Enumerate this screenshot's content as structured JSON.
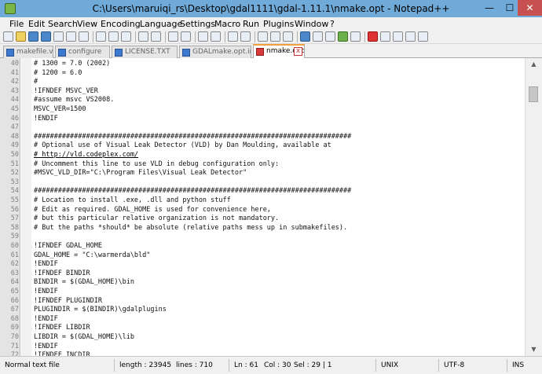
{
  "window": {
    "title": "C:\\Users\\maruiqi_rs\\Desktop\\gdal1111\\gdal-1.11.1\\nmake.opt - Notepad++",
    "minimize_glyph": "—",
    "maximize_glyph": "☐",
    "close_glyph": "✕"
  },
  "menu": [
    "File",
    "Edit",
    "Search",
    "View",
    "Encoding",
    "Language",
    "Settings",
    "Macro",
    "Run",
    "Plugins",
    "Window",
    "?"
  ],
  "tabs": [
    {
      "label": "makefile.vc",
      "active": false
    },
    {
      "label": "configure",
      "active": false
    },
    {
      "label": "LICENSE.TXT",
      "active": false
    },
    {
      "label": "GDALmake.opt.in",
      "active": false
    },
    {
      "label": "nmake.opt",
      "active": true
    }
  ],
  "tab_close_glyph": "x",
  "editor": {
    "current_line": 61,
    "highlighted_line": 61,
    "lines": [
      {
        "n": "40",
        "text": "# 1300 = 7.0 (2002)"
      },
      {
        "n": "41",
        "text": "# 1200 = 6.0"
      },
      {
        "n": "42",
        "text": "#"
      },
      {
        "n": "43",
        "text": "!IFNDEF MSVC_VER"
      },
      {
        "n": "44",
        "text": "#assume msvc VS2008."
      },
      {
        "n": "45",
        "text": "MSVC_VER=1500"
      },
      {
        "n": "46",
        "text": "!ENDIF"
      },
      {
        "n": "47",
        "text": ""
      },
      {
        "n": "48",
        "text": "###############################################################################"
      },
      {
        "n": "49",
        "text": "# Optional use of Visual Leak Detector (VLD) by Dan Moulding, available at"
      },
      {
        "n": "50",
        "text": "# http://vld.codeplex.com/"
      },
      {
        "n": "51",
        "text": "# Uncomment this line to use VLD in debug configuration only:"
      },
      {
        "n": "52",
        "text": "#MSVC_VLD_DIR=\"C:\\Program Files\\Visual Leak Detector\""
      },
      {
        "n": "53",
        "text": ""
      },
      {
        "n": "54",
        "text": "###############################################################################"
      },
      {
        "n": "55",
        "text": "# Location to install .exe, .dll and python stuff"
      },
      {
        "n": "56",
        "text": "# Edit as required. GDAL_HOME is used for convenience here,"
      },
      {
        "n": "57",
        "text": "# but this particular relative organization is not mandatory."
      },
      {
        "n": "58",
        "text": "# But the paths *should* be absolute (relative paths mess up in submakefiles)."
      },
      {
        "n": "59",
        "text": ""
      },
      {
        "n": "60",
        "text": "!IFNDEF GDAL_HOME"
      },
      {
        "n": "61",
        "text": "GDAL_HOME = \"C:\\warmerda\\bld\""
      },
      {
        "n": "62",
        "text": "!ENDIF"
      },
      {
        "n": "63",
        "text": "!IFNDEF BINDIR"
      },
      {
        "n": "64",
        "text": "BINDIR = $(GDAL_HOME)\\bin"
      },
      {
        "n": "65",
        "text": "!ENDIF"
      },
      {
        "n": "66",
        "text": "!IFNDEF PLUGINDIR"
      },
      {
        "n": "67",
        "text": "PLUGINDIR = $(BINDIR)\\gdalplugins"
      },
      {
        "n": "68",
        "text": "!ENDIF"
      },
      {
        "n": "69",
        "text": "!IFNDEF LIBDIR"
      },
      {
        "n": "70",
        "text": "LIBDIR = $(GDAL_HOME)\\lib"
      },
      {
        "n": "71",
        "text": "!ENDIF"
      },
      {
        "n": "72",
        "text": "!IFNDEF INCDIR"
      }
    ]
  },
  "scroll_position": 0.06,
  "status": {
    "file_type": "Normal text file",
    "length": "length : 23945",
    "lines": "lines : 710",
    "ln": "Ln : 61",
    "col": "Col : 30",
    "sel": "Sel : 29 | 1",
    "eol": "UNIX",
    "encoding": "UTF-8",
    "mode": "INS"
  },
  "colors": {
    "titlebar": "#6faad8",
    "current_line": "#e8e8ff",
    "highlight_box": "#e05050",
    "active_tab_accent": "#f5a040"
  }
}
